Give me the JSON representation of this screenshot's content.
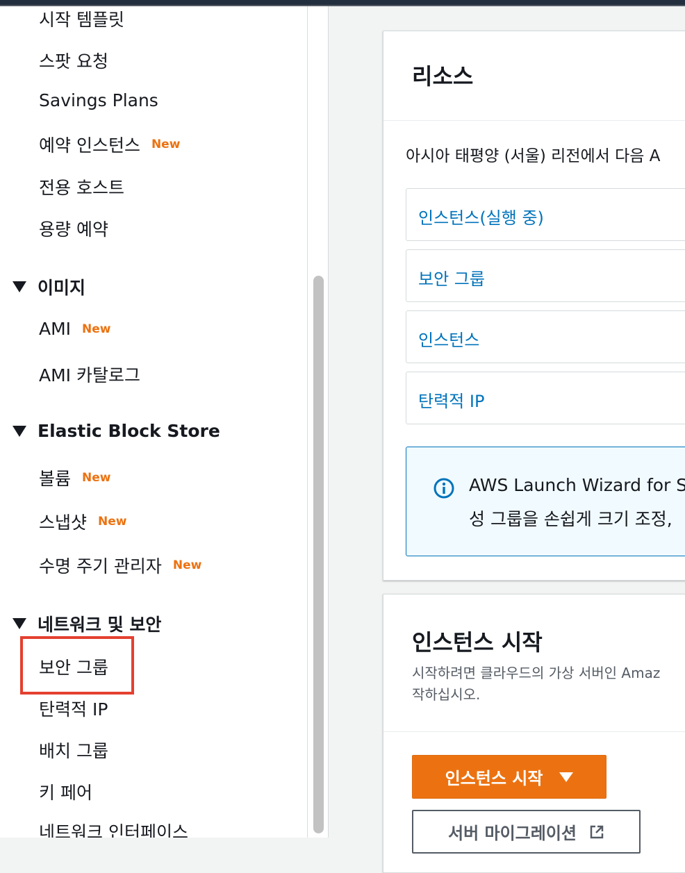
{
  "sidebar": {
    "items_top": [
      {
        "label": "시작 템플릿",
        "badge": ""
      },
      {
        "label": "스팟 요청",
        "badge": ""
      },
      {
        "label": "Savings Plans",
        "badge": ""
      },
      {
        "label": "예약 인스턴스",
        "badge": "New"
      },
      {
        "label": "전용 호스트",
        "badge": ""
      },
      {
        "label": "용량 예약",
        "badge": ""
      }
    ],
    "sections": [
      {
        "title": "이미지",
        "items": [
          {
            "label": "AMI",
            "badge": "New"
          },
          {
            "label": "AMI 카탈로그",
            "badge": ""
          }
        ]
      },
      {
        "title": "Elastic Block Store",
        "items": [
          {
            "label": "볼륨",
            "badge": "New"
          },
          {
            "label": "스냅샷",
            "badge": "New"
          },
          {
            "label": "수명 주기 관리자",
            "badge": "New"
          }
        ]
      },
      {
        "title": "네트워크 및 보안",
        "items": [
          {
            "label": "보안 그룹",
            "badge": ""
          },
          {
            "label": "탄력적 IP",
            "badge": ""
          },
          {
            "label": "배치 그룹",
            "badge": ""
          },
          {
            "label": "키 페어",
            "badge": ""
          },
          {
            "label": "네트워크 인터페이스",
            "badge": ""
          }
        ]
      }
    ]
  },
  "resources": {
    "title": "리소스",
    "description": "아시아 태평양 (서울) 리전에서 다음 A",
    "items": [
      "인스턴스(실행 중)",
      "보안 그룹",
      "인스턴스",
      "탄력적 IP"
    ],
    "info_line1": "AWS Launch Wizard for S",
    "info_line2": "성 그룹을 손쉽게 크기 조정, "
  },
  "launch": {
    "title": "인스턴스 시작",
    "desc_line1": "시작하려면 클라우드의 가상 서버인 Amaz",
    "desc_line2": "작하십시오.",
    "primary_button": "인스턴스 시작",
    "secondary_button": "서버 마이그레이션"
  },
  "colors": {
    "accent_orange": "#ec7211",
    "link_blue": "#0073bb",
    "highlight_red": "#e4402f",
    "nav_dark": "#232f3e"
  }
}
